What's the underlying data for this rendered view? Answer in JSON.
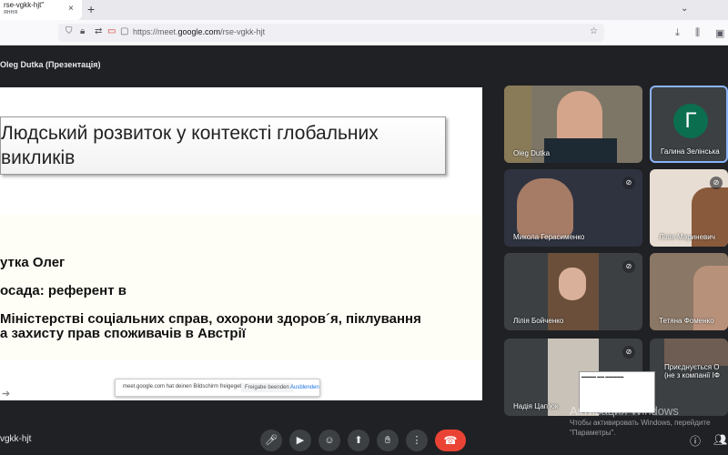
{
  "browser": {
    "tab_title": "rse-vgkk-hjt\"",
    "tab_subtitle": "яння",
    "tab_close": "×",
    "new_tab": "+",
    "url_prefix": "https://meet.",
    "url_domain": "google.com",
    "url_path": "/rse-vgkk-hjt",
    "icons": [
      "shield-icon",
      "lock-icon",
      "camera-permission-icon",
      "star-icon",
      "download-icon",
      "library-icon",
      "account-icon"
    ]
  },
  "meet": {
    "presenter_label": "Oleg Dutka (Презентація)",
    "meeting_code": "vgkk-hjt"
  },
  "slide": {
    "title": "Людський розвиток у контексті глобальних викликів",
    "lines": [
      "утка Олег",
      "осада: референт в",
      "Міністерстві соціальних справ, охорони здоров´я, піклування",
      "а захисту прав споживачів в Австрії"
    ]
  },
  "share_bar": {
    "text": "meet.google.com hat deinen Bildschirm freigegeben.",
    "stop_label": "Freigabe beenden",
    "hide_label": "Ausblenden"
  },
  "participants": [
    {
      "name": "Oleg Dutka",
      "muted": false
    },
    {
      "name": "Галина Зелінська",
      "muted": false,
      "initial": "Г"
    },
    {
      "name": "Микола Герасименко",
      "muted": true
    },
    {
      "name": "Лілія Мариневич",
      "muted": true
    },
    {
      "name": "Лілія Бойченко",
      "muted": true
    },
    {
      "name": "Тетяна Фоменко",
      "muted": true
    },
    {
      "name": "Надія Цапʼюк",
      "muted": true
    },
    {
      "name": "Приєднується О (не з компанії ІФ",
      "muted": false
    }
  ],
  "windows_activation": {
    "title": "Активация Windows",
    "subtitle": "Чтобы активировать Windows, перейдите \"Параметры\"."
  },
  "colors": {
    "meet_bg": "#202124",
    "end_call": "#ea4335",
    "avatar": "#0b6e4f",
    "active_border": "#8ab4f8"
  }
}
